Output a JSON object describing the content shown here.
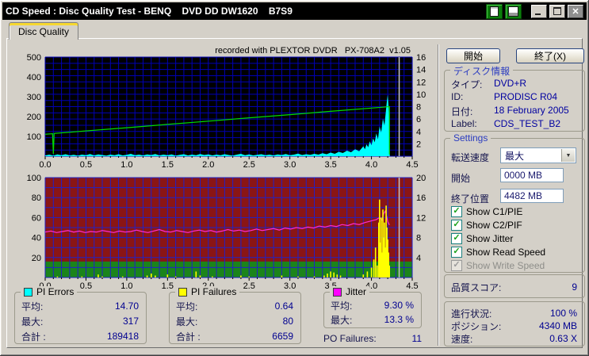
{
  "icons": {
    "close": "✕",
    "check": "✓",
    "dropdown_arrow": "▼"
  },
  "window": {
    "title": "CD Speed : Disc Quality Test - BENQ    DVD DD DW1620    B7S9"
  },
  "tab": {
    "label": "Disc Quality"
  },
  "chart_data": [
    {
      "type": "area",
      "title": "recorded with PLEXTOR DVDR   PX-708A2  v1.05",
      "bg_color": "#000000",
      "grid_color": "#0000b6",
      "h_divisions": 16,
      "position_marker_x": 4.34,
      "x_axis": {
        "min": 0,
        "max": 4.5,
        "ticks": [
          "0.0",
          "0.5",
          "1.0",
          "1.5",
          "2.0",
          "2.5",
          "3.0",
          "3.5",
          "4.0",
          "4.5"
        ]
      },
      "y_left": {
        "min": 0,
        "max": 500,
        "ticks": [
          500,
          400,
          300,
          200,
          100
        ]
      },
      "y_right": {
        "min": 0,
        "max": 16,
        "ticks": [
          16,
          14,
          12,
          10,
          8,
          6,
          4,
          2
        ]
      },
      "series": [
        {
          "name": "PI Errors",
          "style": "area",
          "axis": "left",
          "color": "#00ffff",
          "points": [
            [
              0,
              4
            ],
            [
              0.05,
              8
            ],
            [
              0.1,
              3
            ],
            [
              0.15,
              9
            ],
            [
              0.2,
              5
            ],
            [
              0.25,
              10
            ],
            [
              0.3,
              4
            ],
            [
              0.35,
              7
            ],
            [
              0.4,
              3
            ],
            [
              0.45,
              8
            ],
            [
              0.5,
              5
            ],
            [
              0.55,
              11
            ],
            [
              0.6,
              4
            ],
            [
              0.65,
              9
            ],
            [
              0.7,
              6
            ],
            [
              0.75,
              3
            ],
            [
              0.8,
              8
            ],
            [
              0.85,
              5
            ],
            [
              0.9,
              10
            ],
            [
              0.95,
              4
            ],
            [
              1,
              7
            ],
            [
              1.05,
              12
            ],
            [
              1.1,
              5
            ],
            [
              1.15,
              8
            ],
            [
              1.2,
              4
            ],
            [
              1.25,
              9
            ],
            [
              1.3,
              6
            ],
            [
              1.35,
              11
            ],
            [
              1.4,
              4
            ],
            [
              1.45,
              8
            ],
            [
              1.5,
              5
            ],
            [
              1.55,
              9
            ],
            [
              1.6,
              3
            ],
            [
              1.65,
              7
            ],
            [
              1.7,
              10
            ],
            [
              1.75,
              4
            ],
            [
              1.8,
              8
            ],
            [
              1.85,
              5
            ],
            [
              1.9,
              11
            ],
            [
              1.95,
              6
            ],
            [
              2,
              9
            ],
            [
              2.05,
              4
            ],
            [
              2.1,
              8
            ],
            [
              2.15,
              5
            ],
            [
              2.2,
              10
            ],
            [
              2.25,
              6
            ],
            [
              2.3,
              3
            ],
            [
              2.35,
              8
            ],
            [
              2.4,
              12
            ],
            [
              2.45,
              5
            ],
            [
              2.5,
              9
            ],
            [
              2.55,
              4
            ],
            [
              2.6,
              7
            ],
            [
              2.65,
              10
            ],
            [
              2.7,
              5
            ],
            [
              2.75,
              8
            ],
            [
              2.8,
              4
            ],
            [
              2.85,
              9
            ],
            [
              2.9,
              6
            ],
            [
              2.95,
              11
            ],
            [
              3,
              5
            ],
            [
              3.05,
              8
            ],
            [
              3.1,
              13
            ],
            [
              3.15,
              6
            ],
            [
              3.2,
              10
            ],
            [
              3.25,
              7
            ],
            [
              3.3,
              12
            ],
            [
              3.35,
              8
            ],
            [
              3.4,
              15
            ],
            [
              3.45,
              10
            ],
            [
              3.5,
              18
            ],
            [
              3.55,
              12
            ],
            [
              3.6,
              22
            ],
            [
              3.65,
              16
            ],
            [
              3.7,
              28
            ],
            [
              3.75,
              20
            ],
            [
              3.8,
              35
            ],
            [
              3.85,
              25
            ],
            [
              3.9,
              50
            ],
            [
              3.92,
              35
            ],
            [
              3.94,
              60
            ],
            [
              3.96,
              45
            ],
            [
              3.98,
              75
            ],
            [
              4,
              55
            ],
            [
              4.02,
              90
            ],
            [
              4.04,
              70
            ],
            [
              4.06,
              115
            ],
            [
              4.08,
              85
            ],
            [
              4.1,
              150
            ],
            [
              4.12,
              120
            ],
            [
              4.14,
              190
            ],
            [
              4.16,
              155
            ],
            [
              4.18,
              240
            ],
            [
              4.19,
              280
            ],
            [
              4.2,
              310
            ],
            [
              4.21,
              250
            ],
            [
              4.22,
              150
            ],
            [
              4.225,
              0
            ]
          ]
        },
        {
          "name": "Read Speed",
          "style": "line",
          "axis": "right",
          "color": "#00dd00",
          "points": [
            [
              0,
              3.55
            ],
            [
              0.09,
              3.64
            ],
            [
              0.1,
              0.35
            ],
            [
              0.11,
              3.67
            ],
            [
              0.5,
              4.08
            ],
            [
              1,
              4.6
            ],
            [
              1.5,
              5.13
            ],
            [
              2,
              5.66
            ],
            [
              2.5,
              6.19
            ],
            [
              3,
              6.71
            ],
            [
              3.5,
              7.24
            ],
            [
              4,
              7.77
            ],
            [
              4.2,
              7.98
            ],
            [
              4.22,
              8
            ],
            [
              4.22,
              0.3
            ]
          ]
        }
      ]
    },
    {
      "type": "area",
      "bg_color": "#8a1515",
      "safe_zone_max": 16,
      "safe_zone_color": "#1b841b",
      "grid_color": "#2121c8",
      "h_divisions": 10,
      "position_marker_x": 4.34,
      "x_axis": {
        "min": 0,
        "max": 4.5,
        "ticks": [
          "0.0",
          "0.5",
          "1.0",
          "1.5",
          "2.0",
          "2.5",
          "3.0",
          "3.5",
          "4.0",
          "4.5"
        ]
      },
      "y_left": {
        "min": 0,
        "max": 100,
        "ticks": [
          100,
          80,
          60,
          40,
          20
        ]
      },
      "y_right": {
        "min": 0,
        "max": 20,
        "ticks": [
          20,
          16,
          12,
          8,
          4
        ]
      },
      "series": [
        {
          "name": "Jitter",
          "style": "line",
          "axis": "left",
          "color": "#ff2ad2",
          "plot_scale": 5,
          "points": [
            [
              0,
              9.1
            ],
            [
              0.07,
              9.3
            ],
            [
              0.14,
              9.0
            ],
            [
              0.21,
              9.2
            ],
            [
              0.28,
              9.4
            ],
            [
              0.35,
              9.1
            ],
            [
              0.42,
              9.3
            ],
            [
              0.49,
              9.0
            ],
            [
              0.56,
              9.2
            ],
            [
              0.63,
              9.1
            ],
            [
              0.7,
              9.4
            ],
            [
              0.77,
              9.2
            ],
            [
              0.84,
              9.0
            ],
            [
              0.91,
              9.3
            ],
            [
              0.98,
              9.1
            ],
            [
              1.05,
              9.2
            ],
            [
              1.12,
              9.5
            ],
            [
              1.19,
              9.2
            ],
            [
              1.26,
              9.0
            ],
            [
              1.33,
              9.3
            ],
            [
              1.4,
              9.6
            ],
            [
              1.47,
              9.2
            ],
            [
              1.54,
              9.1
            ],
            [
              1.61,
              9.4
            ],
            [
              1.68,
              9.2
            ],
            [
              1.75,
              9.0
            ],
            [
              1.82,
              9.3
            ],
            [
              1.89,
              9.5
            ],
            [
              1.96,
              9.2
            ],
            [
              2.03,
              9.4
            ],
            [
              2.1,
              9.1
            ],
            [
              2.17,
              9.3
            ],
            [
              2.24,
              9.6
            ],
            [
              2.31,
              9.3
            ],
            [
              2.38,
              9.5
            ],
            [
              2.45,
              9.2
            ],
            [
              2.52,
              9.4
            ],
            [
              2.59,
              9.7
            ],
            [
              2.66,
              9.4
            ],
            [
              2.73,
              9.6
            ],
            [
              2.8,
              9.8
            ],
            [
              2.87,
              9.5
            ],
            [
              2.94,
              9.9
            ],
            [
              3.01,
              9.7
            ],
            [
              3.08,
              10.0
            ],
            [
              3.15,
              9.8
            ],
            [
              3.22,
              10.1
            ],
            [
              3.29,
              9.9
            ],
            [
              3.36,
              10.3
            ],
            [
              3.43,
              10.1
            ],
            [
              3.5,
              10.4
            ],
            [
              3.57,
              10.2
            ],
            [
              3.64,
              10.6
            ],
            [
              3.71,
              10.4
            ],
            [
              3.78,
              10.8
            ],
            [
              3.85,
              10.6
            ],
            [
              3.92,
              11.0
            ],
            [
              3.99,
              11.3
            ],
            [
              4.06,
              11.6
            ],
            [
              4.1,
              12.0
            ],
            [
              4.13,
              11.5
            ],
            [
              4.15,
              12.8
            ],
            [
              4.17,
              13.3
            ],
            [
              4.19,
              12.0
            ],
            [
              4.2,
              11.2
            ],
            [
              4.22,
              10.5
            ]
          ]
        },
        {
          "name": "PI Failures",
          "style": "bars",
          "axis": "left",
          "color": "#ffff00",
          "points": [
            [
              0.15,
              1
            ],
            [
              0.45,
              1
            ],
            [
              0.65,
              3
            ],
            [
              0.7,
              1
            ],
            [
              0.95,
              1
            ],
            [
              1.25,
              2
            ],
            [
              1.3,
              4
            ],
            [
              1.35,
              2
            ],
            [
              1.5,
              3
            ],
            [
              1.6,
              1
            ],
            [
              1.85,
              6
            ],
            [
              1.9,
              2
            ],
            [
              2.05,
              1
            ],
            [
              2.4,
              2
            ],
            [
              2.5,
              1
            ],
            [
              2.9,
              2
            ],
            [
              3.1,
              1
            ],
            [
              3.3,
              1
            ],
            [
              3.42,
              2
            ],
            [
              3.46,
              4
            ],
            [
              3.5,
              6
            ],
            [
              3.54,
              5
            ],
            [
              3.58,
              3
            ],
            [
              3.62,
              2
            ],
            [
              3.9,
              3
            ],
            [
              3.95,
              6
            ],
            [
              4,
              10
            ],
            [
              4.03,
              18
            ],
            [
              4.05,
              30
            ],
            [
              4.07,
              12
            ],
            [
              4.09,
              55
            ],
            [
              4.1,
              78
            ],
            [
              4.11,
              35
            ],
            [
              4.12,
              60
            ],
            [
              4.13,
              25
            ],
            [
              4.14,
              68
            ],
            [
              4.15,
              40
            ],
            [
              4.16,
              55
            ],
            [
              4.17,
              30
            ],
            [
              4.18,
              72
            ],
            [
              4.19,
              50
            ],
            [
              4.2,
              38
            ],
            [
              4.21,
              25
            ],
            [
              4.22,
              12
            ]
          ]
        }
      ]
    }
  ],
  "stats": {
    "pi_errors": {
      "title": "PI Errors",
      "legend_color": "#00ffff",
      "rows": [
        {
          "label": "平均:",
          "value": "14.70"
        },
        {
          "label": "最大:",
          "value": "317"
        },
        {
          "label": "合計 :",
          "value": "189418"
        }
      ]
    },
    "pi_failures": {
      "title": "PI Failures",
      "legend_color": "#ffff00",
      "rows": [
        {
          "label": "平均:",
          "value": "0.64"
        },
        {
          "label": "最大:",
          "value": "80"
        },
        {
          "label": "合計 :",
          "value": "6659"
        }
      ]
    },
    "jitter": {
      "title": "Jitter",
      "legend_color": "#ff00ff",
      "rows": [
        {
          "label": "平均:",
          "value": "9.30 %"
        },
        {
          "label": "最大:",
          "value": "13.3 %"
        }
      ]
    },
    "po_failures": {
      "label": "PO Failures:",
      "value": "11"
    }
  },
  "sidebar": {
    "start_button": "開始",
    "exit_button": "終了(X)",
    "disc_info": {
      "title": "ディスク情報",
      "rows": [
        {
          "label": "タイプ:",
          "value": "DVD+R"
        },
        {
          "label": "ID:",
          "value": "PRODISC R04"
        },
        {
          "label": "日付:",
          "value": "18 February 2005"
        },
        {
          "label": "Label:",
          "value": "CDS_TEST_B2"
        }
      ]
    },
    "settings": {
      "title": "Settings",
      "speed_label": "転送速度",
      "speed_value": "最大",
      "start_label": "開始",
      "start_value": "0000 MB",
      "end_label": "終了位置",
      "end_value": "4482 MB",
      "checkboxes": [
        {
          "label": "Show C1/PIE",
          "checked": true,
          "enabled": true
        },
        {
          "label": "Show C2/PIF",
          "checked": true,
          "enabled": true
        },
        {
          "label": "Show Jitter",
          "checked": true,
          "enabled": true
        },
        {
          "label": "Show Read Speed",
          "checked": true,
          "enabled": true
        },
        {
          "label": "Show Write Speed",
          "checked": true,
          "enabled": false
        }
      ]
    },
    "quality": {
      "label": "品質スコア:",
      "value": "9"
    },
    "progress": {
      "rows": [
        {
          "label": "進行状況:",
          "value": "100 %"
        },
        {
          "label": "ポジション:",
          "value": "4340 MB"
        },
        {
          "label": "速度:",
          "value": "0.63 X"
        }
      ]
    }
  }
}
